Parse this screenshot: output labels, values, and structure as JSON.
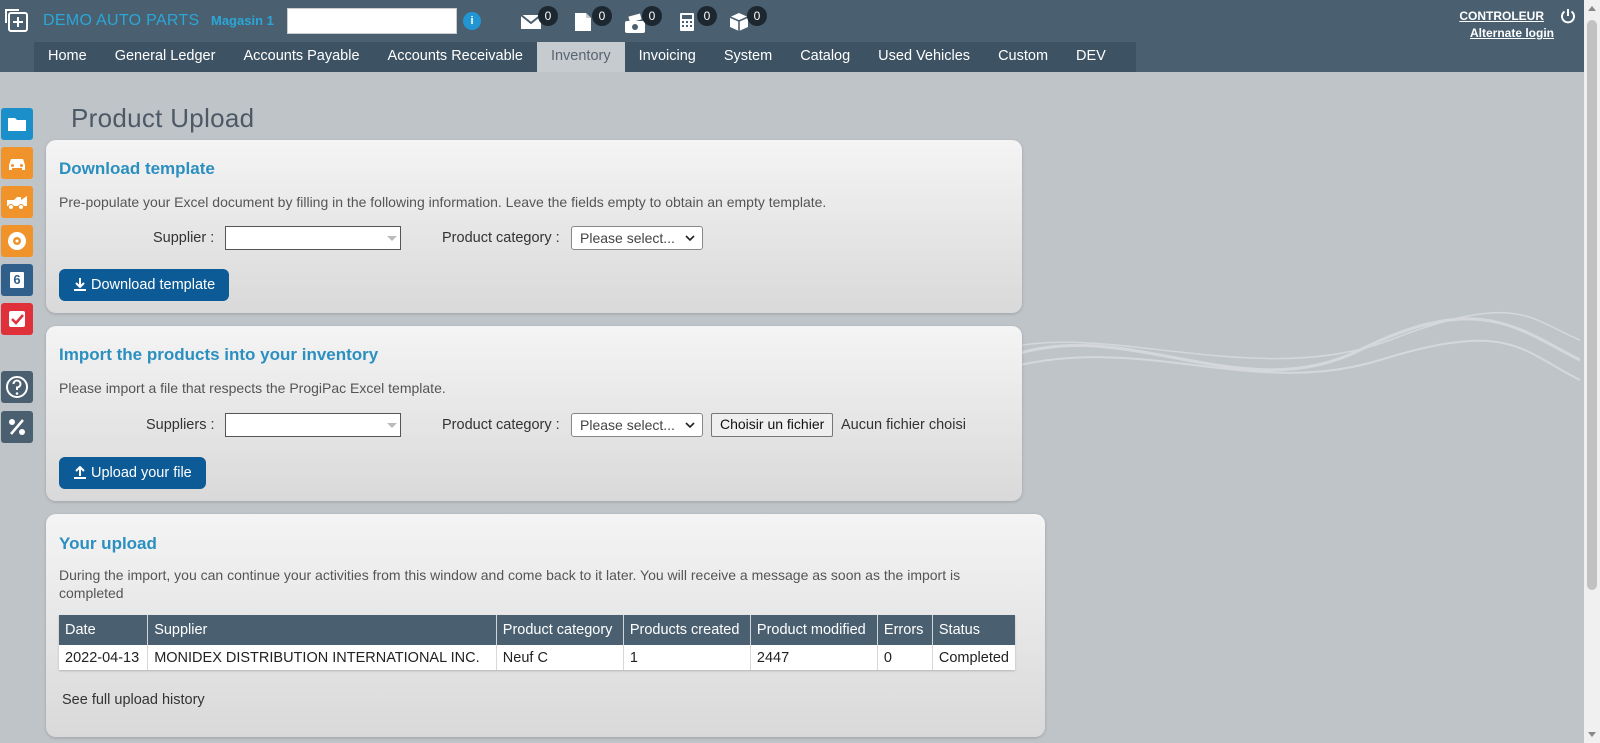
{
  "header": {
    "company": "DEMO AUTO PARTS",
    "store_label": "Magasin 1",
    "store_value": "",
    "counters": {
      "messages": "0",
      "documents": "0",
      "cash": "0",
      "calculator": "0",
      "packages": "0"
    },
    "user": "CONTROLEUR",
    "alternate_login": "Alternate login"
  },
  "nav": {
    "tabs": [
      "Home",
      "General Ledger",
      "Accounts Payable",
      "Accounts Receivable",
      "Inventory",
      "Invoicing",
      "System",
      "Catalog",
      "Used Vehicles",
      "Custom",
      "DEV"
    ],
    "active": "Inventory"
  },
  "sidebar": {
    "items": [
      {
        "icon": "folder-icon",
        "color": "#1a8fc9"
      },
      {
        "icon": "car-icon",
        "color": "#f0932b"
      },
      {
        "icon": "tow-truck-icon",
        "color": "#f0932b"
      },
      {
        "icon": "tire-icon",
        "color": "#f0932b"
      },
      {
        "icon": "number-six-icon",
        "color": "#2f5f8a"
      },
      {
        "icon": "checkmark-icon",
        "color": "#e0303a"
      },
      {
        "icon": "help-icon",
        "color": "#4a5f70"
      },
      {
        "icon": "percent-icon",
        "color": "#4a5f70"
      }
    ],
    "six_label": "6"
  },
  "page": {
    "title": "Product Upload"
  },
  "download": {
    "title": "Download template",
    "description": "Pre-populate your Excel document by filling in the following information. Leave the fields empty to obtain an empty template.",
    "supplier_label": "Supplier :",
    "category_label": "Product category :",
    "category_value": "Please select...",
    "button": "Download template"
  },
  "import": {
    "title": "Import the products into your inventory",
    "description": "Please import a file that respects the ProgiPac Excel template.",
    "supplier_label": "Suppliers :",
    "category_label": "Product category :",
    "category_value": "Please select...",
    "file_button": "Choisir un fichier",
    "file_status": "Aucun fichier choisi",
    "button": "Upload your file"
  },
  "uploads": {
    "title": "Your upload",
    "description": "During the import, you can continue your activities from this window and come back to it later. You will receive a message as soon as the import is completed",
    "columns": [
      "Date",
      "Supplier",
      "Product category",
      "Products created",
      "Product modified",
      "Errors",
      "Status"
    ],
    "rows": [
      [
        "2022-04-13",
        "MONIDEX DISTRIBUTION INTERNATIONAL INC.",
        "Neuf C",
        "1",
        "2447",
        "0",
        "Completed"
      ]
    ],
    "history_link": "See full upload history"
  },
  "colors": {
    "topbar": "#4a5f70",
    "accent": "#2b8fc0",
    "button": "#0d5b96"
  }
}
